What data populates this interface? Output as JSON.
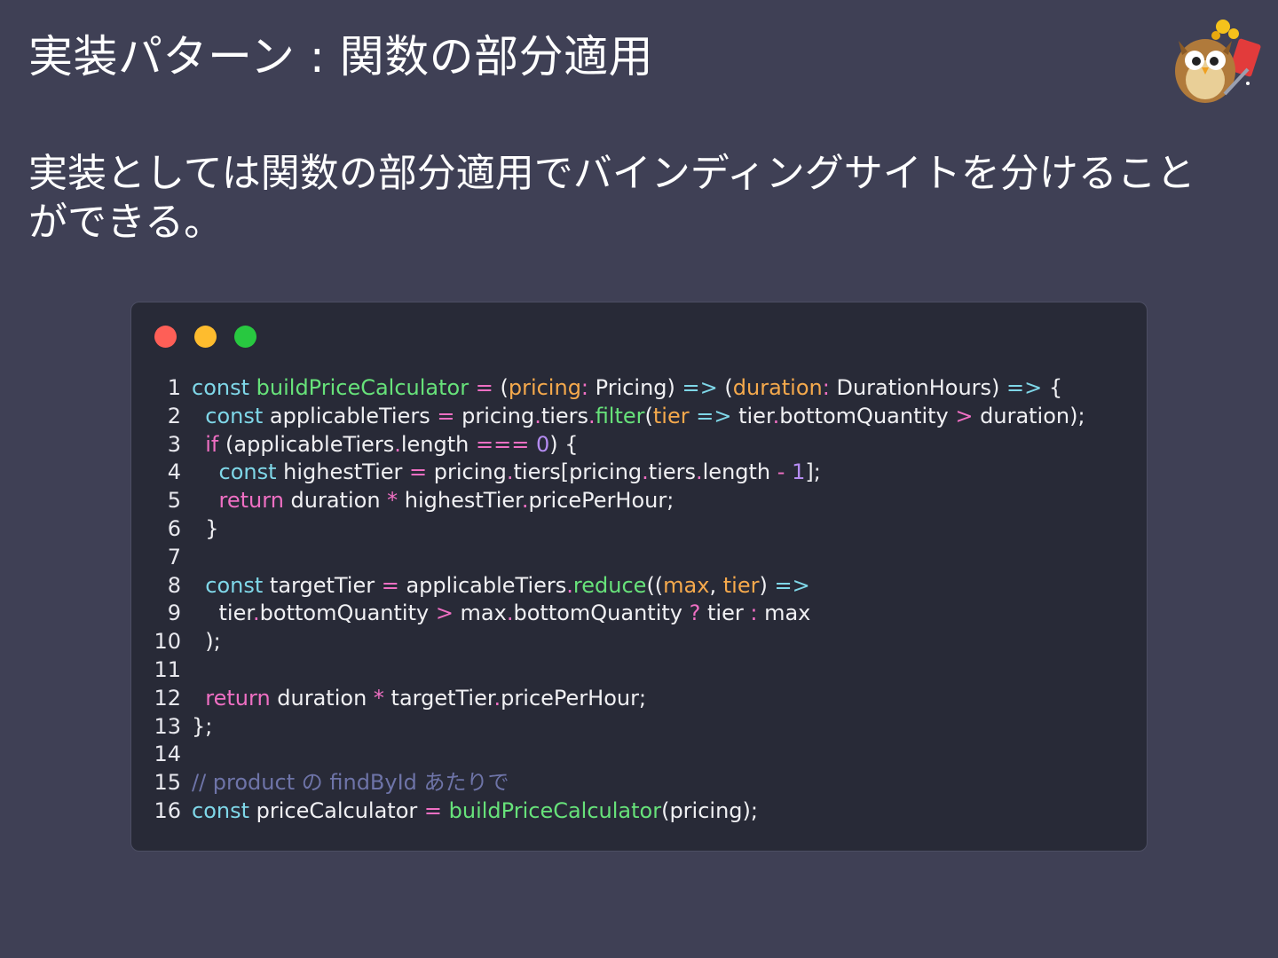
{
  "slide": {
    "title": "実装パターン : 関数の部分適用",
    "body": "実装としては関数の部分適用でバインディングサイトを分けることができる。"
  },
  "colors": {
    "background": "#3f4055",
    "code_background": "#282a37",
    "keyword": "#7fd7e8",
    "function": "#67e27a",
    "parameter": "#f5a94c",
    "operator": "#ef6fc3",
    "number": "#b58cf2",
    "comment": "#6e74a8"
  },
  "window_controls": [
    "close-dot",
    "minimize-dot",
    "maximize-dot"
  ],
  "code": {
    "lines": [
      {
        "n": "1",
        "tokens": [
          {
            "t": "const",
            "c": "kw"
          },
          {
            "t": " "
          },
          {
            "t": "buildPriceCalculator",
            "c": "fn"
          },
          {
            "t": " "
          },
          {
            "t": "=",
            "c": "op"
          },
          {
            "t": " ("
          },
          {
            "t": "pricing",
            "c": "pa"
          },
          {
            "t": ":",
            "c": "op"
          },
          {
            "t": " Pricing) "
          },
          {
            "t": "=>",
            "c": "kw"
          },
          {
            "t": " ("
          },
          {
            "t": "duration",
            "c": "pa"
          },
          {
            "t": ":",
            "c": "op"
          },
          {
            "t": " DurationHours) "
          },
          {
            "t": "=>",
            "c": "kw"
          },
          {
            "t": " {"
          }
        ]
      },
      {
        "n": "2",
        "tokens": [
          {
            "t": "  "
          },
          {
            "t": "const",
            "c": "kw"
          },
          {
            "t": " applicableTiers "
          },
          {
            "t": "=",
            "c": "op"
          },
          {
            "t": " pricing"
          },
          {
            "t": ".",
            "c": "op"
          },
          {
            "t": "tiers"
          },
          {
            "t": ".",
            "c": "op"
          },
          {
            "t": "filter",
            "c": "fn"
          },
          {
            "t": "("
          },
          {
            "t": "tier",
            "c": "pa"
          },
          {
            "t": " "
          },
          {
            "t": "=>",
            "c": "kw"
          },
          {
            "t": " tier"
          },
          {
            "t": ".",
            "c": "op"
          },
          {
            "t": "bottomQuantity "
          },
          {
            "t": ">",
            "c": "op"
          },
          {
            "t": " duration);"
          }
        ]
      },
      {
        "n": "3",
        "tokens": [
          {
            "t": "  "
          },
          {
            "t": "if",
            "c": "rt"
          },
          {
            "t": " (applicableTiers"
          },
          {
            "t": ".",
            "c": "op"
          },
          {
            "t": "length "
          },
          {
            "t": "===",
            "c": "op"
          },
          {
            "t": " "
          },
          {
            "t": "0",
            "c": "nm"
          },
          {
            "t": ") {"
          }
        ]
      },
      {
        "n": "4",
        "tokens": [
          {
            "t": "    "
          },
          {
            "t": "const",
            "c": "kw"
          },
          {
            "t": " highestTier "
          },
          {
            "t": "=",
            "c": "op"
          },
          {
            "t": " pricing"
          },
          {
            "t": ".",
            "c": "op"
          },
          {
            "t": "tiers[pricing"
          },
          {
            "t": ".",
            "c": "op"
          },
          {
            "t": "tiers"
          },
          {
            "t": ".",
            "c": "op"
          },
          {
            "t": "length "
          },
          {
            "t": "-",
            "c": "op"
          },
          {
            "t": " "
          },
          {
            "t": "1",
            "c": "nm"
          },
          {
            "t": "];"
          }
        ]
      },
      {
        "n": "5",
        "tokens": [
          {
            "t": "    "
          },
          {
            "t": "return",
            "c": "rt"
          },
          {
            "t": " duration "
          },
          {
            "t": "*",
            "c": "op"
          },
          {
            "t": " highestTier"
          },
          {
            "t": ".",
            "c": "op"
          },
          {
            "t": "pricePerHour;"
          }
        ]
      },
      {
        "n": "6",
        "tokens": [
          {
            "t": "  }"
          }
        ]
      },
      {
        "n": "7",
        "tokens": []
      },
      {
        "n": "8",
        "tokens": [
          {
            "t": "  "
          },
          {
            "t": "const",
            "c": "kw"
          },
          {
            "t": " targetTier "
          },
          {
            "t": "=",
            "c": "op"
          },
          {
            "t": " applicableTiers"
          },
          {
            "t": ".",
            "c": "op"
          },
          {
            "t": "reduce",
            "c": "fn"
          },
          {
            "t": "(("
          },
          {
            "t": "max",
            "c": "pa"
          },
          {
            "t": ", "
          },
          {
            "t": "tier",
            "c": "pa"
          },
          {
            "t": ") "
          },
          {
            "t": "=>",
            "c": "kw"
          }
        ]
      },
      {
        "n": "9",
        "tokens": [
          {
            "t": "    tier"
          },
          {
            "t": ".",
            "c": "op"
          },
          {
            "t": "bottomQuantity "
          },
          {
            "t": ">",
            "c": "op"
          },
          {
            "t": " max"
          },
          {
            "t": ".",
            "c": "op"
          },
          {
            "t": "bottomQuantity "
          },
          {
            "t": "?",
            "c": "op"
          },
          {
            "t": " tier "
          },
          {
            "t": ":",
            "c": "op"
          },
          {
            "t": " max"
          }
        ]
      },
      {
        "n": "10",
        "tokens": [
          {
            "t": "  );"
          }
        ]
      },
      {
        "n": "11",
        "tokens": []
      },
      {
        "n": "12",
        "tokens": [
          {
            "t": "  "
          },
          {
            "t": "return",
            "c": "rt"
          },
          {
            "t": " duration "
          },
          {
            "t": "*",
            "c": "op"
          },
          {
            "t": " targetTier"
          },
          {
            "t": ".",
            "c": "op"
          },
          {
            "t": "pricePerHour;"
          }
        ]
      },
      {
        "n": "13",
        "tokens": [
          {
            "t": "};"
          }
        ]
      },
      {
        "n": "14",
        "tokens": []
      },
      {
        "n": "15",
        "tokens": [
          {
            "t": "// product の findById あたりで",
            "c": "cm"
          }
        ]
      },
      {
        "n": "16",
        "tokens": [
          {
            "t": "const",
            "c": "kw"
          },
          {
            "t": " priceCalculator "
          },
          {
            "t": "=",
            "c": "op"
          },
          {
            "t": " "
          },
          {
            "t": "buildPriceCalculator",
            "c": "fn"
          },
          {
            "t": "(pricing);"
          }
        ]
      }
    ]
  }
}
